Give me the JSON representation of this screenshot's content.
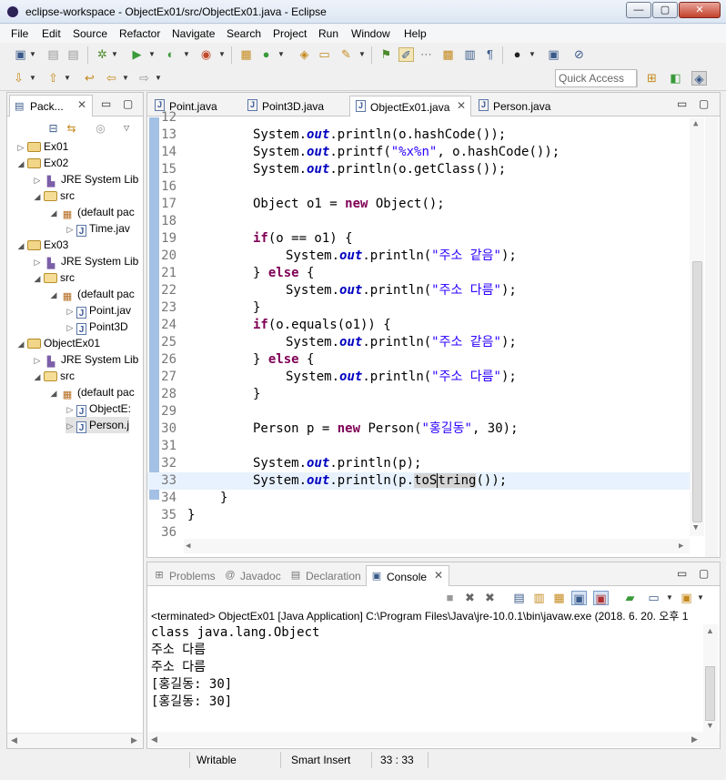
{
  "window": {
    "title": "eclipse-workspace - ObjectEx01/src/ObjectEx01.java - Eclipse",
    "controls": {
      "minimize": "—",
      "maximize": "▢",
      "close": "✕"
    }
  },
  "menu": [
    "File",
    "Edit",
    "Source",
    "Refactor",
    "Navigate",
    "Search",
    "Project",
    "Run",
    "Window",
    "Help"
  ],
  "quick_access": {
    "placeholder": "Quick Access"
  },
  "package_explorer": {
    "tab_label": "Pack...",
    "tree": [
      {
        "label": "Ex01",
        "icon": "project-icon"
      },
      {
        "label": "Ex02",
        "icon": "project-icon"
      },
      {
        "label": "JRE System Lib",
        "icon": "library-icon"
      },
      {
        "label": "src",
        "icon": "source-folder-icon"
      },
      {
        "label": "(default pac",
        "icon": "package-icon"
      },
      {
        "label": "Time.jav",
        "icon": "java-file-icon"
      },
      {
        "label": "Ex03",
        "icon": "project-icon"
      },
      {
        "label": "JRE System Lib",
        "icon": "library-icon"
      },
      {
        "label": "src",
        "icon": "source-folder-icon"
      },
      {
        "label": "(default pac",
        "icon": "package-icon"
      },
      {
        "label": "Point.jav",
        "icon": "java-file-icon"
      },
      {
        "label": "Point3D",
        "icon": "java-file-icon"
      },
      {
        "label": "ObjectEx01",
        "icon": "project-icon"
      },
      {
        "label": "JRE System Lib",
        "icon": "library-icon"
      },
      {
        "label": "src",
        "icon": "source-folder-icon"
      },
      {
        "label": "(default pac",
        "icon": "package-icon"
      },
      {
        "label": "ObjectE:",
        "icon": "java-file-icon"
      },
      {
        "label": "Person.j",
        "icon": "java-file-icon"
      }
    ]
  },
  "editor": {
    "tabs": [
      {
        "label": "Point.java",
        "active": false
      },
      {
        "label": "Point3D.java",
        "active": false
      },
      {
        "label": "ObjectEx01.java",
        "active": true
      },
      {
        "label": "Person.java",
        "active": false
      }
    ],
    "line_numbers": [
      "12",
      "13",
      "14",
      "15",
      "16",
      "17",
      "18",
      "19",
      "20",
      "21",
      "22",
      "23",
      "24",
      "25",
      "26",
      "27",
      "28",
      "29",
      "30",
      "31",
      "32",
      "33",
      "34",
      "35",
      "36"
    ],
    "tokens": {
      "sys": "System.",
      "out": "out",
      "println": ".println(",
      "printf": ".printf(",
      "hash_arg": "o.hashCode());",
      "fmt": "\"%x%n\"",
      "fmt_rest": ", o.hashCode());",
      "getclass_arg": "o.getClass());",
      "object_decl": "Object o1 = ",
      "new": "new",
      "object_ctor": " Object();",
      "if": "if",
      "if1_cond": "(o == o1) {",
      "if2_cond": "(o.equals(o1)) {",
      "same": "\"주소 같음\"",
      "diff": "\"주소 다름\"",
      "close_stmt": ");",
      "close_brace": "} ",
      "else": "else",
      "open_brace": " {",
      "rbrace": "}",
      "person_decl": "Person p = ",
      "person_ctor": " Person(",
      "person_name": "\"홍길동\"",
      "person_age": ", 30);",
      "p_arg": "p);",
      "p_dot": "p.",
      "to_s": "toS",
      "tring": "tring",
      "tostring_end": "());"
    }
  },
  "console": {
    "tabs": [
      {
        "label": "Problems",
        "icon": "problems-icon"
      },
      {
        "label": "Javadoc",
        "icon": "javadoc-icon"
      },
      {
        "label": "Declaration",
        "icon": "declaration-icon"
      },
      {
        "label": "Console",
        "icon": "console-icon",
        "active": true
      }
    ],
    "status_line": "<terminated> ObjectEx01 [Java Application] C:\\Program Files\\Java\\jre-10.0.1\\bin\\javaw.exe (2018. 6. 20. 오후 1",
    "output": [
      "class java.lang.Object",
      "주소 다름",
      "주소 다름",
      "[홍길동: 30]",
      "[홍길동: 30]"
    ]
  },
  "status_bar": {
    "writable": "Writable",
    "insert_mode": "Smart Insert",
    "position": "33 : 33"
  }
}
